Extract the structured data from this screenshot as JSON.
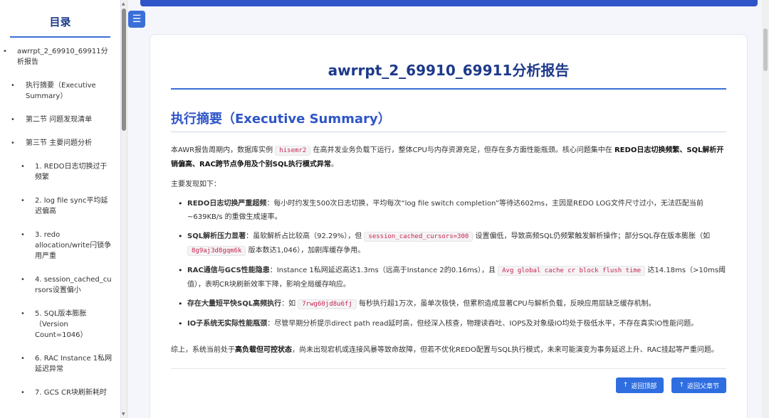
{
  "sidebar": {
    "title": "目录",
    "items": [
      {
        "bullet": "•",
        "label": "awrrpt_2_69910_69911分析报告"
      },
      {
        "bullet": "•",
        "label": "执行摘要（Executive Summary）"
      },
      {
        "bullet": "•",
        "label": "第二节 问题发现清单"
      },
      {
        "bullet": "•",
        "label": "第三节 主要问题分析"
      },
      {
        "bullet": "•",
        "label": "1. REDO日志切换过于频繁"
      },
      {
        "bullet": "•",
        "label": "2. log file sync平均延迟偏高"
      },
      {
        "bullet": "•",
        "label": "3. redo allocation/write闩锁争用严重"
      },
      {
        "bullet": "•",
        "label": "4. session_cached_cursors设置偏小"
      },
      {
        "bullet": "•",
        "label": "5. SQL版本膨胀（Version Count=1046）"
      },
      {
        "bullet": "•",
        "label": "6. RAC Instance 1私网延迟异常"
      },
      {
        "bullet": "•",
        "label": "7. GCS CR块刷新耗时"
      }
    ]
  },
  "toggle_icon": "☰",
  "report": {
    "title": "awrrpt_2_69910_69911分析报告",
    "section_title": "执行摘要（Executive Summary）",
    "intro": {
      "t1": "本AWR报告周期内，数据库实例",
      "code1": "hisemr2",
      "t2": "在高并发业务负载下运行，整体CPU与内存资源充足，但存在多方面性能瓶颈。核心问题集中在",
      "b1": "REDO日志切换频繁、SQL解析开销偏高、RAC跨节点争用及个别SQL执行模式异常",
      "t3": "。"
    },
    "findings_lead": "主要发现如下：",
    "findings": [
      {
        "bold": "REDO日志切换严重超频",
        "text": "：每小时约发生500次日志切换，平均每次“log file switch completion”等待达602ms，主因是REDO LOG文件尺寸过小，无法匹配当前~639KB/s 的重做生成速率。"
      },
      {
        "bold": "SQL解析压力显著",
        "t1": "：虽软解析占比较高（92.29%），但",
        "code1": "session_cached_cursors=300",
        "t2": "设置偏低，导致高频SQL仍频繁触发解析操作；部分SQL存在版本膨胀（如",
        "code2": "8g9aj3d8gqm6k",
        "t3": "版本数达1,046），加剧库缓存争用。"
      },
      {
        "bold": "RAC通信与GCS性能隐患",
        "t1": "：Instance 1私网延迟高达1.3ms（远高于Instance 2的0.16ms），且",
        "code1": "Avg global cache cr block flush time",
        "t2": "达14.18ms（>10ms阈值），表明CR块刷新效率下降，影响全局缓存响应。"
      },
      {
        "bold": "存在大量短平快SQL高频执行",
        "t1": "：如",
        "code1": "7rwg60jd8u6fj",
        "t2": "每秒执行超1万次，虽单次极快，但累积造成显著CPU与解析负载，反映应用层缺乏缓存机制。"
      },
      {
        "bold": "IO子系统无实际性能瓶颈",
        "text": "：尽管早期分析提示direct path read延时高，但经深入核查，物理读吞吐、IOPS及对象级IO均处于极低水平，不存在真实IO性能问题。"
      }
    ],
    "conclusion": {
      "t1": "综上，系统当前处于",
      "b1": "高负载但可控状态",
      "t2": "，尚未出现宕机或连接风暴等致命故障，但若不优化REDO配置与SQL执行模式，未来可能演变为事务延迟上升、RAC挂起等严重问题。"
    },
    "buttons": {
      "top_arrow": "↑",
      "top_label": "返回顶部",
      "parent_arrow": "↑",
      "parent_label": "返回父章节"
    }
  }
}
